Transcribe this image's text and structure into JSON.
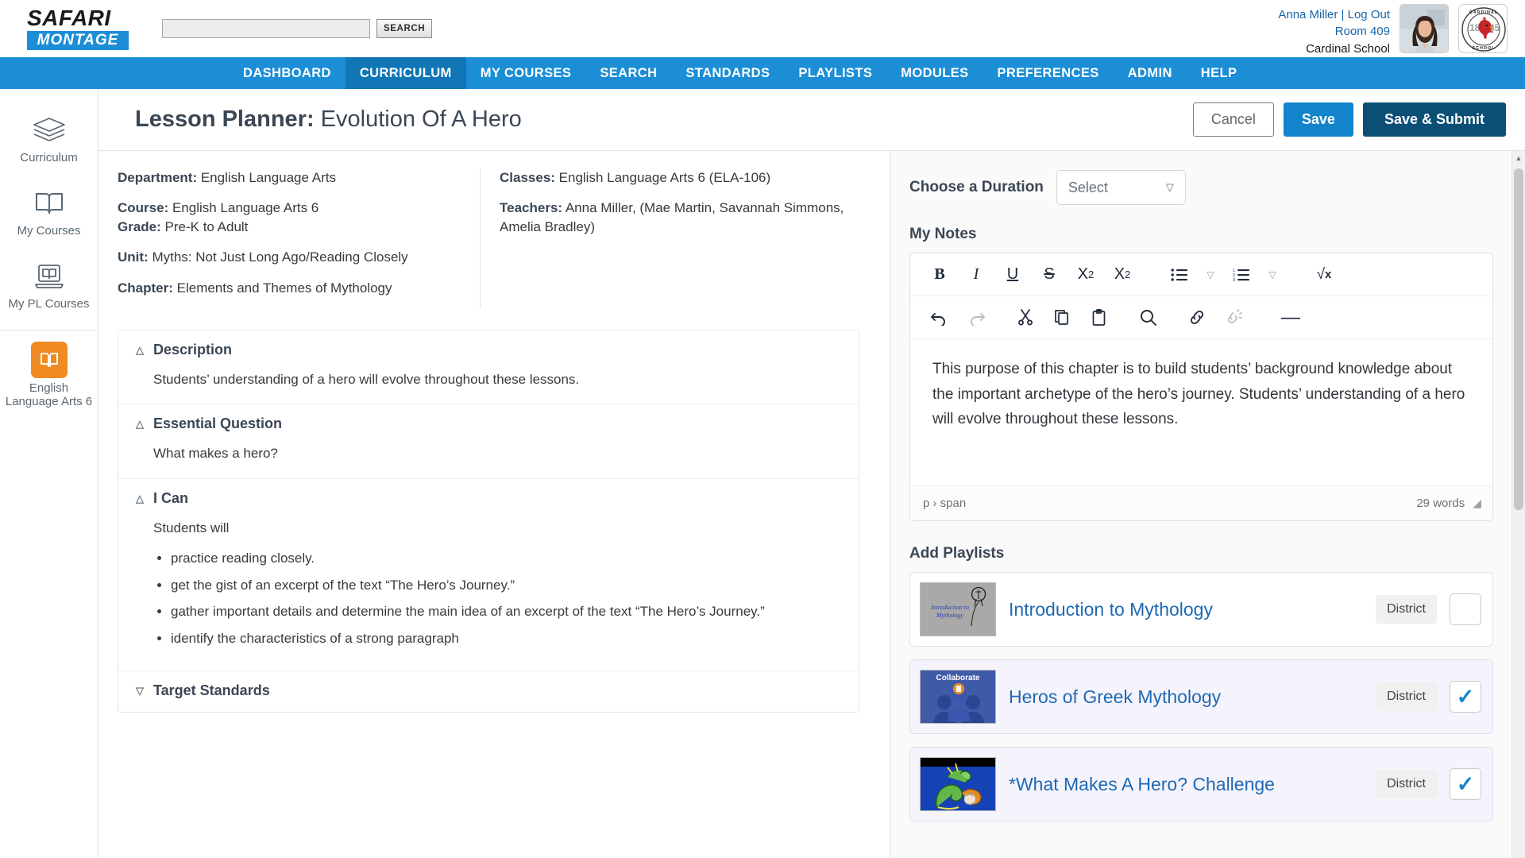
{
  "brand": {
    "name_top": "SAFARI",
    "name_bottom": "MONTAGE"
  },
  "search": {
    "value": "",
    "placeholder": "",
    "button_label": "SEARCH"
  },
  "user": {
    "name": "Anna Miller",
    "separator": "|",
    "logout_label": "Log Out",
    "room": "Room 409",
    "school": "Cardinal School",
    "badge_text_left": "18",
    "badge_text_right": "45",
    "badge_top": "CARDINAL",
    "badge_bottom": "SCHOOL"
  },
  "nav": {
    "items": [
      {
        "label": "DASHBOARD",
        "active": false
      },
      {
        "label": "CURRICULUM",
        "active": true
      },
      {
        "label": "MY COURSES",
        "active": false
      },
      {
        "label": "SEARCH",
        "active": false
      },
      {
        "label": "STANDARDS",
        "active": false
      },
      {
        "label": "PLAYLISTS",
        "active": false
      },
      {
        "label": "MODULES",
        "active": false
      },
      {
        "label": "PREFERENCES",
        "active": false
      },
      {
        "label": "ADMIN",
        "active": false
      },
      {
        "label": "HELP",
        "active": false
      }
    ],
    "accent_color": "#1b8ed6",
    "active_color": "#1176b5"
  },
  "sidebar": {
    "items": [
      {
        "label": "Curriculum",
        "icon": "books-icon"
      },
      {
        "label": "My Courses",
        "icon": "open-book-icon"
      },
      {
        "label": "My PL Courses",
        "icon": "laptop-book-icon"
      }
    ],
    "course": {
      "label": "English Language Arts 6",
      "icon": "book-icon",
      "color": "#ef8b22"
    }
  },
  "header": {
    "title_bold": "Lesson Planner:",
    "title_rest": " Evolution Of A Hero",
    "buttons": {
      "cancel": "Cancel",
      "save": "Save",
      "save_submit": "Save & Submit"
    },
    "colors": {
      "save": "#1383cb",
      "save_submit": "#0b4f76"
    }
  },
  "meta": {
    "left": [
      {
        "label": "Department:",
        "value": " English Language Arts"
      },
      {
        "label": "Course:",
        "value": " English Language Arts 6"
      },
      {
        "label": "Grade:",
        "value": " Pre-K to Adult"
      },
      {
        "label": "Unit:",
        "value": " Myths: Not Just Long Ago/Reading Closely"
      },
      {
        "label": "Chapter:",
        "value": " Elements and Themes of Mythology"
      }
    ],
    "right": [
      {
        "label": "Classes:",
        "value": " English Language Arts 6 (ELA-106)"
      },
      {
        "label": "Teachers:",
        "value": " Anna Miller, (Mae Martin, Savannah Simmons, Amelia Bradley)"
      }
    ]
  },
  "accordion": {
    "description": {
      "title": "Description",
      "state": "expanded",
      "body": "Students’ understanding of a hero will evolve throughout these lessons."
    },
    "essential_question": {
      "title": "Essential Question",
      "state": "expanded",
      "body": "What makes a hero?"
    },
    "i_can": {
      "title": "I Can",
      "state": "expanded",
      "intro": "Students will",
      "items": [
        "practice reading closely.",
        "get the gist of an excerpt of the text “The Hero’s Journey.”",
        "gather important details and determine the main idea of an excerpt of the text “The Hero’s Journey.”",
        "identify the characteristics of a strong paragraph"
      ]
    },
    "target_standards": {
      "title": "Target Standards",
      "state": "collapsed"
    }
  },
  "duration": {
    "label": "Choose a Duration",
    "selected": "Select",
    "options": [
      "Select"
    ]
  },
  "notes": {
    "label": "My Notes",
    "toolbar_row1": [
      {
        "name": "bold-icon",
        "glyph": "B"
      },
      {
        "name": "italic-icon",
        "glyph": "I"
      },
      {
        "name": "underline-icon",
        "glyph": "U"
      },
      {
        "name": "strikethrough-icon",
        "glyph": "S"
      },
      {
        "name": "subscript-icon",
        "glyph": "X₂"
      },
      {
        "name": "superscript-icon",
        "glyph": "X²"
      },
      {
        "name": "bulleted-list-icon",
        "glyph": "☰"
      },
      {
        "name": "bulleted-list-chevron-down-icon",
        "glyph": "˅"
      },
      {
        "name": "numbered-list-icon",
        "glyph": "☰"
      },
      {
        "name": "numbered-list-chevron-down-icon",
        "glyph": "˅"
      },
      {
        "name": "math-equation-icon",
        "glyph": "√x"
      }
    ],
    "toolbar_row2": [
      {
        "name": "undo-icon",
        "glyph": "↶"
      },
      {
        "name": "redo-icon",
        "glyph": "↷"
      },
      {
        "name": "cut-icon",
        "glyph": "✂"
      },
      {
        "name": "copy-icon",
        "glyph": "❐"
      },
      {
        "name": "paste-icon",
        "glyph": "📋"
      },
      {
        "name": "find-icon",
        "glyph": "🔍"
      },
      {
        "name": "link-icon",
        "glyph": "🔗"
      },
      {
        "name": "unlink-icon",
        "glyph": "🔗"
      },
      {
        "name": "horizontal-rule-icon",
        "glyph": "—"
      }
    ],
    "content": "This purpose of this chapter is to build students’ background knowledge about the important archetype of the hero’s journey. Students’ understanding of a hero will evolve throughout these lessons.",
    "status_path": "p › span",
    "status_words": "29 words"
  },
  "playlists": {
    "label": "Add Playlists",
    "badge_label": "District",
    "rows": [
      {
        "title": "Introduction to Mythology",
        "badge": "District",
        "checked": false,
        "thumb": "intro-mythology-thumbnail",
        "thumb_caption": "Introduction to Mythology"
      },
      {
        "title": "Heros of Greek Mythology",
        "badge": "District",
        "checked": true,
        "thumb": "collaborate-thumbnail",
        "thumb_caption": "Collaborate"
      },
      {
        "title": "*What Makes A Hero? Challenge",
        "badge": "District",
        "checked": true,
        "thumb": "dragon-thumbnail",
        "thumb_caption": ""
      }
    ]
  },
  "scrollbar": {
    "up_arrow": "▲",
    "down_arrow": "▼"
  }
}
